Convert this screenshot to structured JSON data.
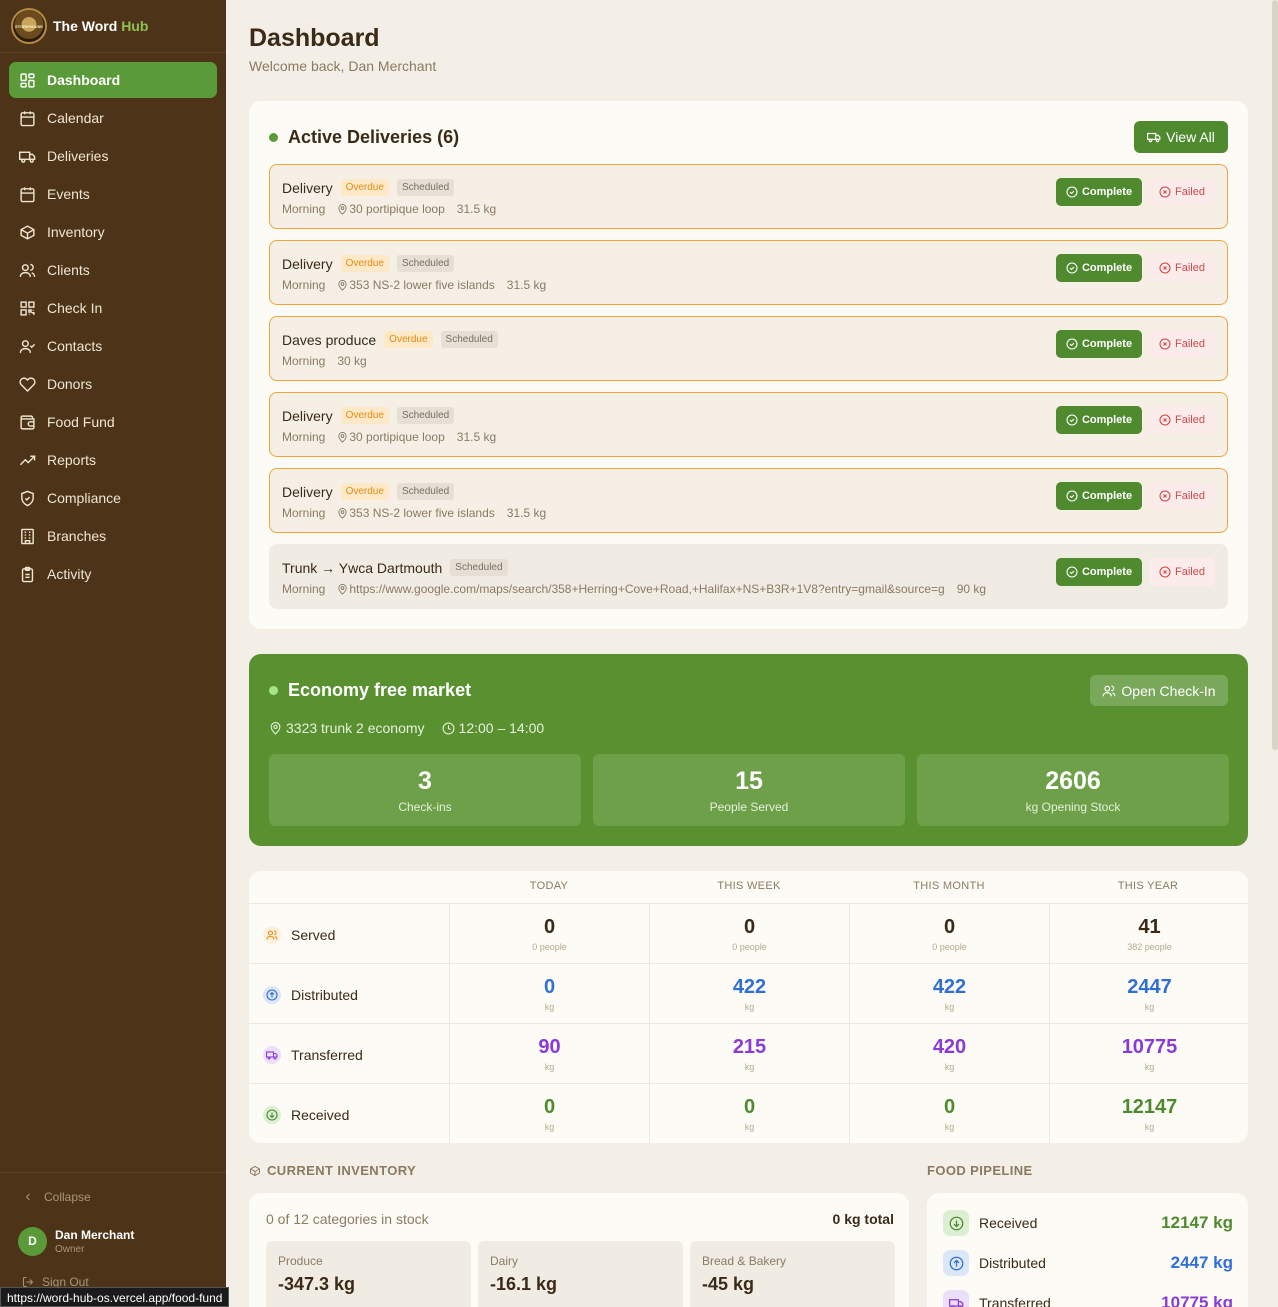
{
  "app": {
    "name": "The Word",
    "name_accent": "Hub",
    "logo_text": "STOREHOUSE"
  },
  "sidebar": {
    "items": [
      {
        "label": "Dashboard",
        "icon": "dashboard-icon",
        "active": true
      },
      {
        "label": "Calendar",
        "icon": "calendar-icon"
      },
      {
        "label": "Deliveries",
        "icon": "truck-icon"
      },
      {
        "label": "Events",
        "icon": "calendar-icon"
      },
      {
        "label": "Inventory",
        "icon": "box-icon"
      },
      {
        "label": "Clients",
        "icon": "users-icon"
      },
      {
        "label": "Check In",
        "icon": "qr-icon"
      },
      {
        "label": "Contacts",
        "icon": "user-check-icon"
      },
      {
        "label": "Donors",
        "icon": "heart-icon"
      },
      {
        "label": "Food Fund",
        "icon": "wallet-icon"
      },
      {
        "label": "Reports",
        "icon": "trend-icon"
      },
      {
        "label": "Compliance",
        "icon": "shield-icon"
      },
      {
        "label": "Branches",
        "icon": "building-icon"
      },
      {
        "label": "Activity",
        "icon": "clipboard-icon"
      }
    ],
    "collapse_label": "Collapse",
    "user": {
      "name": "Dan Merchant",
      "role": "Owner",
      "initial": "D"
    },
    "signout_label": "Sign Out"
  },
  "status_url": "https://word-hub-os.vercel.app/food-fund",
  "page": {
    "title": "Dashboard",
    "welcome": "Welcome back, Dan Merchant"
  },
  "deliveries": {
    "title": "Active Deliveries (6)",
    "view_all": "View All",
    "complete_label": "Complete",
    "failed_label": "Failed",
    "items": [
      {
        "name": "Delivery",
        "overdue": "Overdue",
        "status": "Scheduled",
        "time": "Morning",
        "address": "30 portipique loop",
        "weight": "31.5 kg"
      },
      {
        "name": "Delivery",
        "overdue": "Overdue",
        "status": "Scheduled",
        "time": "Morning",
        "address": "353 NS-2 lower five islands",
        "weight": "31.5 kg"
      },
      {
        "name": "Daves produce",
        "overdue": "Overdue",
        "status": "Scheduled",
        "time": "Morning",
        "address": "",
        "weight": "30 kg"
      },
      {
        "name": "Delivery",
        "overdue": "Overdue",
        "status": "Scheduled",
        "time": "Morning",
        "address": "30 portipique loop",
        "weight": "31.5 kg"
      },
      {
        "name": "Delivery",
        "overdue": "Overdue",
        "status": "Scheduled",
        "time": "Morning",
        "address": "353 NS-2 lower five islands",
        "weight": "31.5 kg"
      },
      {
        "name": "Trunk → Ywca Dartmouth",
        "overdue": "",
        "status": "Scheduled",
        "time": "Morning",
        "address": "https://www.google.com/maps/search/358+Herring+Cove+Road,+Halifax+NS+B3R+1V8?entry=gmail&source=g",
        "weight": "90 kg"
      }
    ]
  },
  "market": {
    "title": "Economy free market",
    "open_checkin": "Open Check-In",
    "location": "3323 trunk 2 economy",
    "time": "12:00 – 14:00",
    "stats": [
      {
        "value": "3",
        "label": "Check-ins"
      },
      {
        "value": "15",
        "label": "People Served"
      },
      {
        "value": "2606",
        "label": "kg Opening Stock"
      }
    ]
  },
  "summary": {
    "columns": [
      "TODAY",
      "THIS WEEK",
      "THIS MONTH",
      "THIS YEAR"
    ],
    "rows": [
      {
        "label": "Served",
        "color": "#3a2a17",
        "icon": "users-icon",
        "cells": [
          {
            "v": "0",
            "u": "0 people"
          },
          {
            "v": "0",
            "u": "0 people"
          },
          {
            "v": "0",
            "u": "0 people"
          },
          {
            "v": "41",
            "u": "382 people"
          }
        ]
      },
      {
        "label": "Distributed",
        "color": "#2f6fd6",
        "icon": "arrow-up-circle-icon",
        "cells": [
          {
            "v": "0",
            "u": "kg"
          },
          {
            "v": "422",
            "u": "kg"
          },
          {
            "v": "422",
            "u": "kg"
          },
          {
            "v": "2447",
            "u": "kg"
          }
        ]
      },
      {
        "label": "Transferred",
        "color": "#8a3ad6",
        "icon": "truck-icon",
        "cells": [
          {
            "v": "90",
            "u": "kg"
          },
          {
            "v": "215",
            "u": "kg"
          },
          {
            "v": "420",
            "u": "kg"
          },
          {
            "v": "10775",
            "u": "kg"
          }
        ]
      },
      {
        "label": "Received",
        "color": "#4f8a2e",
        "icon": "arrow-down-circle-icon",
        "cells": [
          {
            "v": "0",
            "u": "kg"
          },
          {
            "v": "0",
            "u": "kg"
          },
          {
            "v": "0",
            "u": "kg"
          },
          {
            "v": "12147",
            "u": "kg"
          }
        ]
      }
    ]
  },
  "inventory": {
    "section_title": "CURRENT INVENTORY",
    "in_stock": "0 of 12 categories in stock",
    "total": "0 kg total",
    "categories": [
      {
        "name": "Produce",
        "value": "-347.3 kg"
      },
      {
        "name": "Dairy",
        "value": "-16.1 kg"
      },
      {
        "name": "Bread & Bakery",
        "value": "-45 kg"
      }
    ]
  },
  "pipeline": {
    "section_title": "FOOD PIPELINE",
    "rows": [
      {
        "label": "Received",
        "value": "12147 kg",
        "color": "#4f8a2e"
      },
      {
        "label": "Distributed",
        "value": "2447 kg",
        "color": "#2f6fd6"
      },
      {
        "label": "Transferred",
        "value": "10775 kg",
        "color": "#8a3ad6"
      }
    ]
  }
}
